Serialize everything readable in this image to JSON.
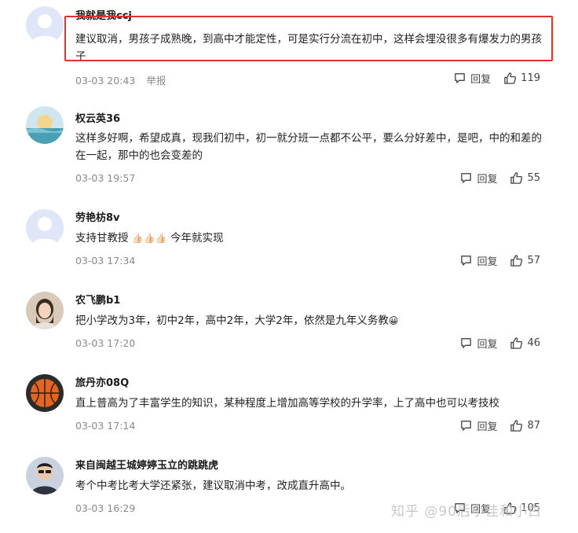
{
  "comments": [
    {
      "username": "我就是我ccj",
      "text": "建议取消，男孩子成熟晚，到高中才能定性，可是实行分流在初中，这样会埋没很多有爆发力的男孩子",
      "time": "03-03 20:43",
      "report": "举报",
      "reply": "回复",
      "likes": "119"
    },
    {
      "username": "权云英36",
      "text": "这样多好啊，希望成真，现我们初中，初一就分班一点都不公平，要么分好差中，是吧，中的和差的在一起，那中的也会变差的",
      "time": "03-03 19:57",
      "reply": "回复",
      "likes": "55"
    },
    {
      "username": "劳艳枋8v",
      "text": "支持甘教授",
      "text_suffix": "今年就实现",
      "time": "03-03 17:34",
      "reply": "回复",
      "likes": "57"
    },
    {
      "username": "农飞鹏b1",
      "text": "把小学改为3年，初中2年，高中2年，大学2年，依然是九年义务教",
      "time": "03-03 17:20",
      "reply": "回复",
      "likes": "46"
    },
    {
      "username": "旅丹亦08Q",
      "text": "直上普高为了丰富学生的知识，某种程度上增加高等学校的升学率，上了高中也可以考技校",
      "time": "03-03 17:14",
      "reply": "回复",
      "likes": "87"
    },
    {
      "username": "来自闽越王城婷婷玉立的跳跳虎",
      "text": "考个中考比考大学还紧张，建议取消中考，改成直升高中。",
      "time": "03-03 16:29",
      "reply": "回复",
      "likes": "105"
    }
  ],
  "watermark": "知乎 @90后小佳和小白",
  "colors": {
    "highlight": "#e0312a",
    "muted": "#8a8a8a"
  }
}
